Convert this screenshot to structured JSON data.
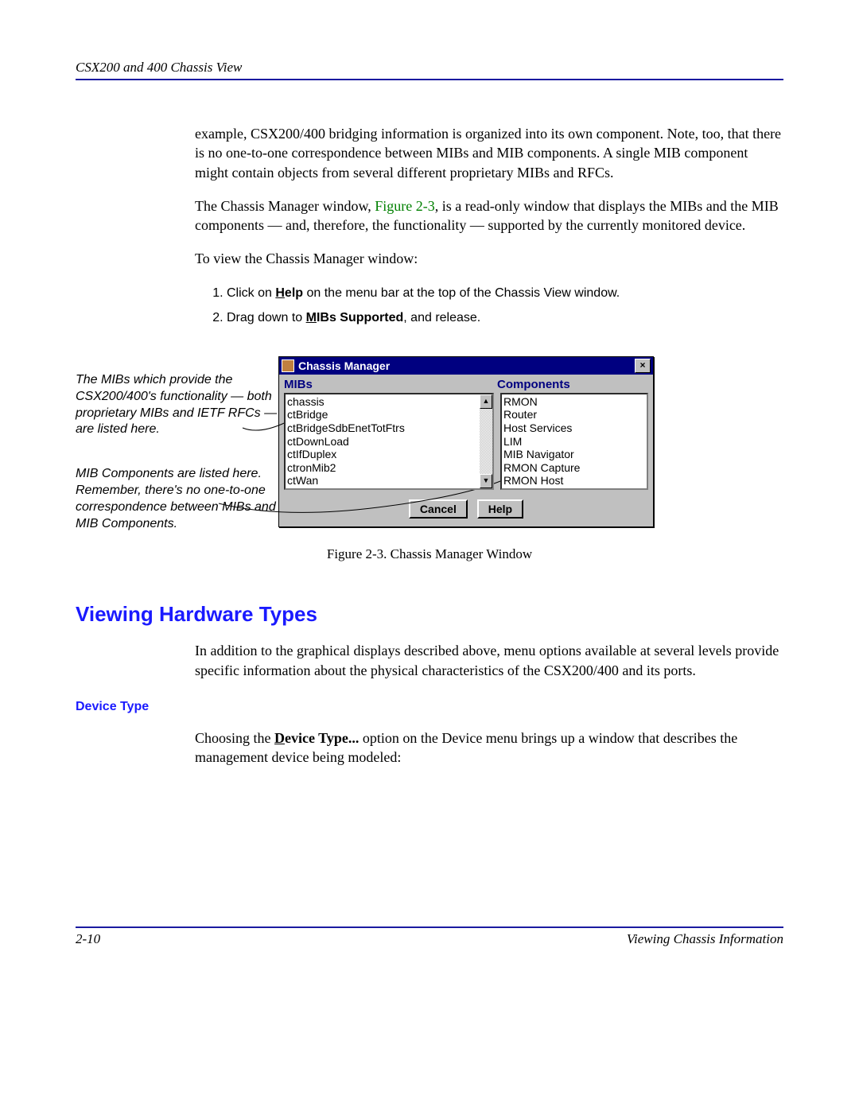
{
  "header": "CSX200 and 400 Chassis View",
  "para1": "example, CSX200/400 bridging information is organized into its own component. Note, too, that there is no one-to-one correspondence between MIBs and MIB components. A single MIB component might contain objects from several different proprietary MIBs and RFCs.",
  "para2a": "The Chassis Manager window, ",
  "para2_link": "Figure 2-3",
  "para2b": ", is a read-only window that displays the MIBs and the MIB components — and, therefore, the functionality — supported by the currently monitored device.",
  "para3": "To view the Chassis Manager window:",
  "step1a": "Click on ",
  "step1b": "H",
  "step1c": "elp",
  "step1d": " on the menu bar at the top of the Chassis View window.",
  "step2a": "Drag down to ",
  "step2b": "M",
  "step2c": "IBs Supported",
  "step2d": ", and release.",
  "callout1": "The MIBs which provide the CSX200/400's functionality — both proprietary MIBs and IETF RFCs — are listed here.",
  "callout2": "MIB Components are listed here. Remember, there's no one-to-one correspondence between MIBs and MIB Components.",
  "win": {
    "title": "Chassis Manager",
    "label_mibs": "MIBs",
    "label_components": "Components",
    "mibs": [
      "chassis",
      "ctBridge",
      "ctBridgeSdbEnetTotFtrs",
      "ctDownLoad",
      "ctIfDuplex",
      "ctronMib2",
      "ctWan"
    ],
    "components": [
      "RMON",
      "Router",
      "Host Services",
      "LIM",
      "MIB Navigator",
      "RMON Capture",
      "RMON Host"
    ],
    "btn_cancel": "Cancel",
    "btn_help": "Help",
    "close": "×"
  },
  "caption": "Figure 2-3. Chassis Manager Window",
  "h2": "Viewing Hardware Types",
  "para4": "In addition to the graphical displays described above, menu options available at several levels provide specific information about the physical characteristics of the CSX200/400 and its ports.",
  "h3": "Device Type",
  "para5a": "Choosing the ",
  "para5b": "D",
  "para5c": "evice Type...",
  "para5d": " option on the Device menu brings up a window that describes the management device being modeled:",
  "footer_left": "2-10",
  "footer_right": "Viewing Chassis Information"
}
